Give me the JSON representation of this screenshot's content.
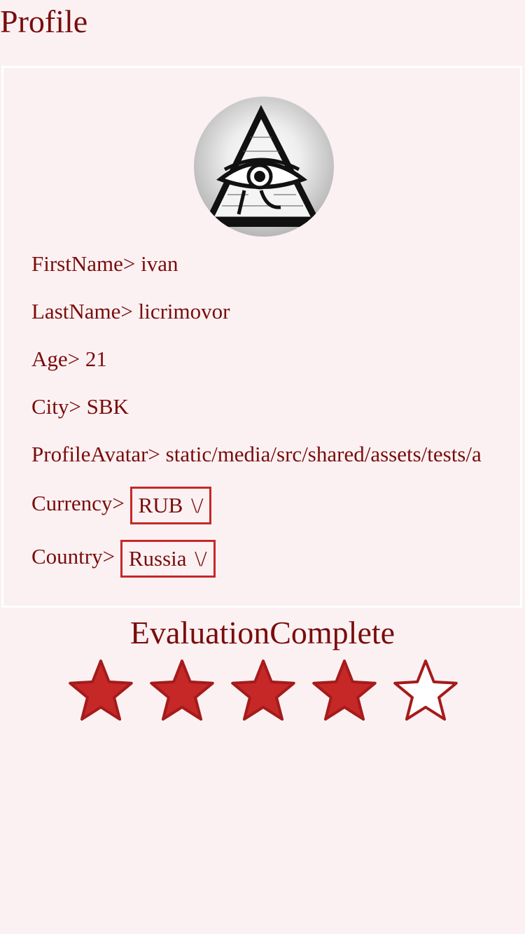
{
  "header": {
    "title": "Profile"
  },
  "profile": {
    "avatar_icon": "eye-of-providence-icon",
    "first_name": {
      "label": "FirstName>",
      "value": "ivan"
    },
    "last_name": {
      "label": "LastName>",
      "value": "licrimovor"
    },
    "age": {
      "label": "Age>",
      "value": "21"
    },
    "city": {
      "label": "City>",
      "value": "SBK"
    },
    "avatar_path": {
      "label": "ProfileAvatar>",
      "value": "static/media/src/shared/assets/tests/a"
    },
    "currency": {
      "label": "Currency>",
      "value": "RUB",
      "arrow": "\\/"
    },
    "country": {
      "label": "Country>",
      "value": "Russia",
      "arrow": "\\/"
    }
  },
  "rating": {
    "title": "EvaluationComplete",
    "value": 4,
    "max": 5,
    "filled_color": "#c62828",
    "outline_color": "#a51b1b"
  }
}
